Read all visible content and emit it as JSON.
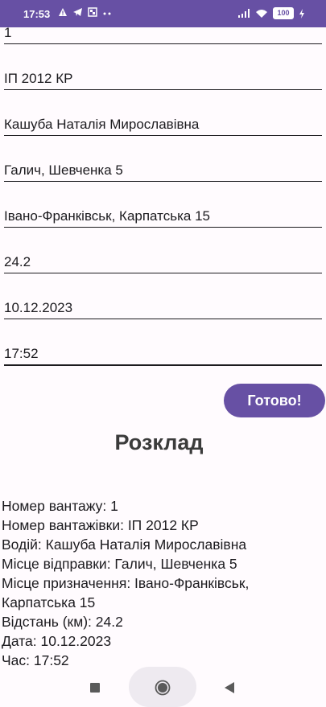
{
  "status_bar": {
    "time": "17:53",
    "left_icons": [
      "warning-icon",
      "telegram-icon",
      "gallery-icon",
      "more-dots-icon"
    ],
    "right_icons": [
      "signal-icon",
      "wifi-icon",
      "battery-icon",
      "charging-icon"
    ],
    "battery_level": "100"
  },
  "form": {
    "cargo_number": "1",
    "truck_number": "ІП 2012 КР",
    "driver": "Кашуба Наталія Мирославівна",
    "departure": "Галич, Шевченка 5",
    "destination": "Івано-Франківськ, Карпатська 15",
    "distance": "24.2",
    "date": "10.12.2023",
    "time": "17:52"
  },
  "done_button": "Готово!",
  "schedule": {
    "title": "Розклад",
    "lines": [
      "Номер вантажу: 1",
      "Номер вантажівки: ІП 2012 КР",
      "Водій: Кашуба Наталія Мирославівна",
      "Місце відправки: Галич, Шевченка 5",
      "Місце призначення: Івано-Франківськ, Карпатська 15",
      "Відстань (км): 24.2",
      "Дата: 10.12.2023",
      "Час: 17:52"
    ]
  },
  "colors": {
    "primary": "#6750a4",
    "background": "#fffbfe",
    "text": "#1c1b1f"
  }
}
